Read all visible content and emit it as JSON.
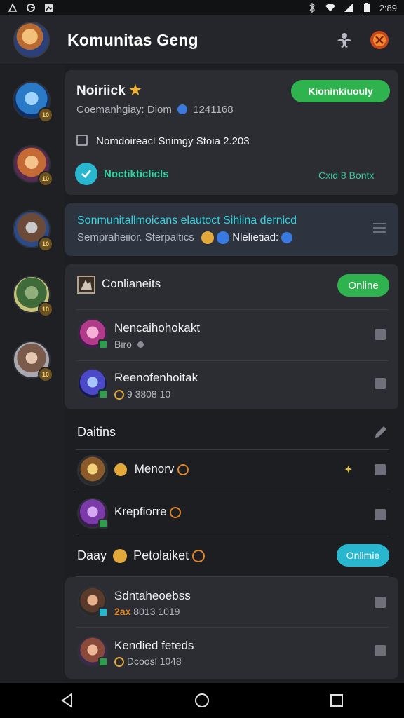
{
  "status_bar": {
    "time": "2:89"
  },
  "header": {
    "title": "Komunitas Geng"
  },
  "rail": {
    "levels": [
      "10",
      "10",
      "10",
      "10",
      "10"
    ]
  },
  "notification_card": {
    "title": "Noiriick",
    "button_label": "Kioninkiuouly",
    "subtitle": "Coemanhgiay: Diom",
    "subtitle_count": "1241168",
    "detail_text": "Nomdoireacl Snimgy  Stoia 2.203",
    "status_label": "Noctikticlicls",
    "link_label": "Cxid 8 Bontx"
  },
  "banner": {
    "headline": "Sonmunitallmoicans elautoct Sihiina dernicd",
    "subline": "Sempraheiior.  Sterpaltics",
    "tag": "Nlelietiad:"
  },
  "contacts": {
    "section_title": "Conlianeits",
    "status_pill": "Online",
    "items": [
      {
        "name": "Nencaihohokakt",
        "sub": "Biro"
      },
      {
        "name": "Reenofenhoitak",
        "sub": "9 3808 10"
      }
    ]
  },
  "dailies": {
    "section_title": "Daitins",
    "items": [
      {
        "name": "Menorv"
      },
      {
        "name": "Krepfiorre"
      }
    ]
  },
  "daily": {
    "section_title": "Daay",
    "section_tag": "Petolaiket",
    "status_pill": "Onlimie",
    "items": [
      {
        "name": "Sdntaheoebss",
        "sub_prefix": "2ax",
        "sub": "8013 1019"
      },
      {
        "name": "Kendied feteds",
        "sub": "Dcoosl 1048"
      }
    ]
  },
  "colors": {
    "accent_green": "#2fb34f",
    "accent_cyan": "#29b6cf",
    "banner_cyan": "#2fd4e0",
    "background": "#1c1e22",
    "card": "#2b2d33"
  }
}
